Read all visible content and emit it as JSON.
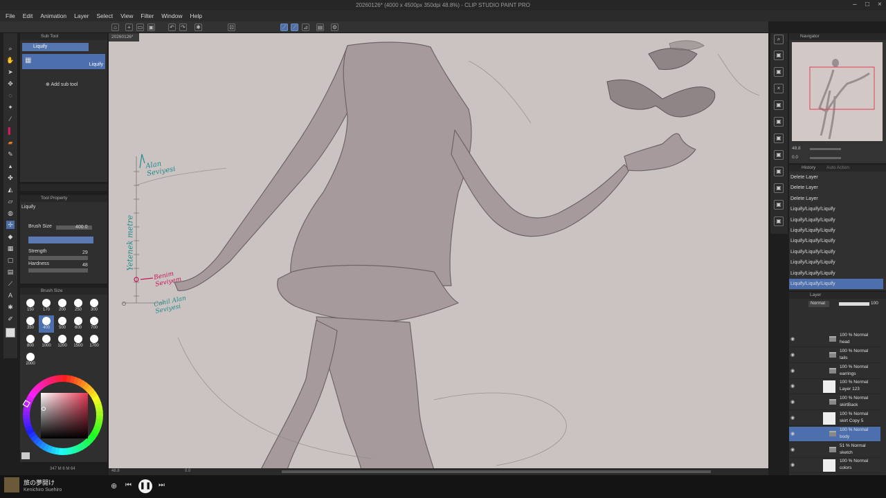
{
  "app": {
    "window_title": "20260126* (4000 x 4500px 350dpi 48.8%) - CLIP STUDIO PAINT PRO"
  },
  "menu": [
    "File",
    "Edit",
    "Animation",
    "Layer",
    "Select",
    "View",
    "Filter",
    "Window",
    "Help"
  ],
  "canvas_tab": "20260126*",
  "subtool": {
    "title": "Sub Tool",
    "group": "Liquify",
    "item": "Liquify",
    "add_label": "Add sub tool"
  },
  "tool_property": {
    "title": "Tool Property",
    "name": "Liquify",
    "brush_size_label": "Brush Size",
    "brush_size_value": "400.0",
    "strength_label": "Strength",
    "strength_value": "29",
    "hardness_label": "Hardness",
    "hardness_value": "48"
  },
  "brush_size_panel": {
    "title": "Brush Size",
    "sizes": [
      "150",
      "170",
      "200",
      "250",
      "300",
      "350",
      "400",
      "500",
      "600",
      "700",
      "800",
      "1000",
      "1200",
      "1500",
      "1700",
      "2000"
    ]
  },
  "canvas_annotations": {
    "top": "Alan Seviyesi",
    "left": "Yetenek metre",
    "middle": "Benim Seviyem",
    "bottom": "Cahil Alan Seviyesi"
  },
  "status": {
    "zoom": "48.8",
    "angle": "0.0",
    "memory": "347 M",
    "mem2": "6 M",
    "mem3": "64"
  },
  "navigator": {
    "title": "Navigator",
    "zoom": "48.8",
    "angle": "0.0"
  },
  "history": {
    "tab1": "History",
    "tab2": "Auto Action",
    "items": [
      "Delete Layer",
      "Delete Layer",
      "Delete Layer",
      "Liquify/Liquify/Liquify",
      "Liquify/Liquify/Liquify",
      "Liquify/Liquify/Liquify",
      "Liquify/Liquify/Liquify",
      "Liquify/Liquify/Liquify",
      "Liquify/Liquify/Liquify",
      "Liquify/Liquify/Liquify",
      "Liquify/Liquify/Liquify"
    ]
  },
  "layer": {
    "title": "Layer",
    "blend": "Normal",
    "opacity": "100",
    "rows": [
      {
        "blend": "100 % Normal",
        "name": "head",
        "type": "folder"
      },
      {
        "blend": "100 % Normal",
        "name": "tails",
        "type": "folder"
      },
      {
        "blend": "100 % Normal",
        "name": "earrings",
        "type": "folder"
      },
      {
        "blend": "100 % Normal",
        "name": "Layer 123",
        "type": "raster"
      },
      {
        "blend": "100 % Normal",
        "name": "skirtBack",
        "type": "folder"
      },
      {
        "blend": "100 % Normal",
        "name": "skirt Copy 5",
        "type": "raster"
      },
      {
        "blend": "100 % Normal",
        "name": "body",
        "type": "folder"
      },
      {
        "blend": "51 % Normal",
        "name": "sketch",
        "type": "folder"
      },
      {
        "blend": "100 % Normal",
        "name": "colors",
        "type": "raster"
      }
    ]
  },
  "player": {
    "title": "旅の夢開け",
    "artist": "Kenichiro Suehiro"
  },
  "colors": {
    "accent": "#4d6fad",
    "main_color": "#c2185b"
  }
}
